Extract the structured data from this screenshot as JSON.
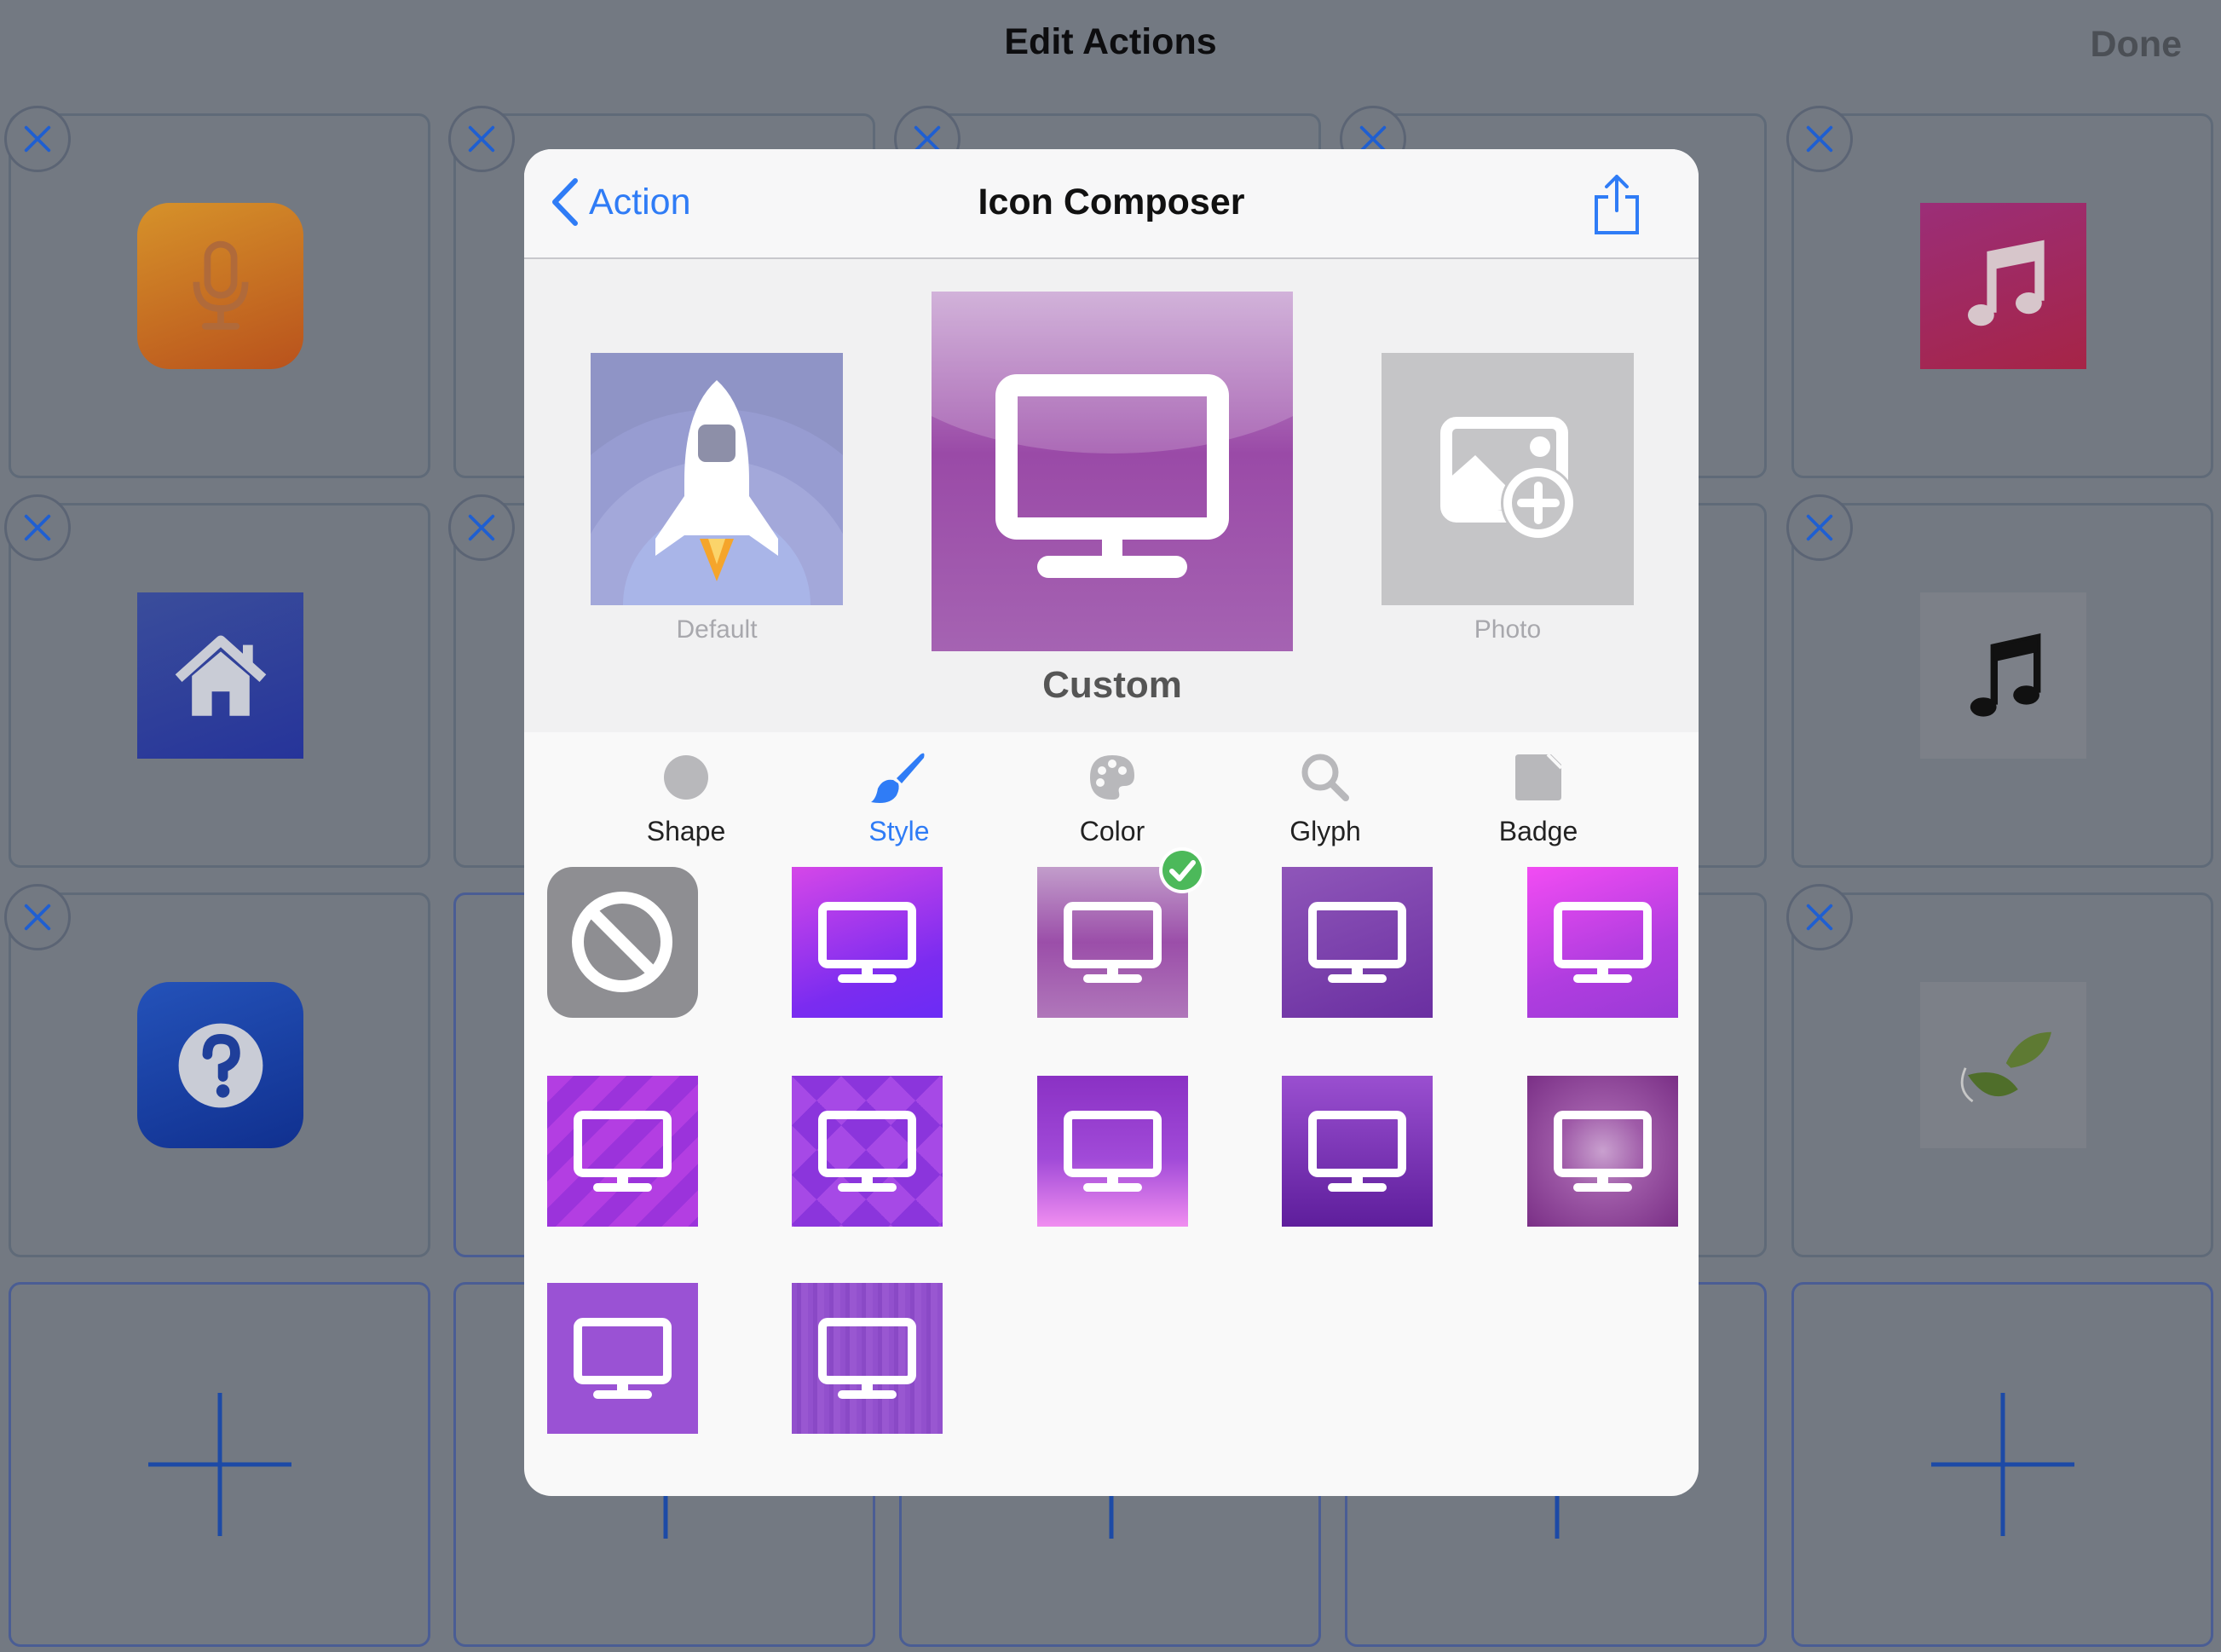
{
  "screen": {
    "title": "Edit Actions",
    "done_label": "Done"
  },
  "background_grid": {
    "icons": [
      "microphone-icon",
      "music-note-icon",
      "home-icon",
      "music-note-black-icon",
      "help-icon",
      "leaf-icon"
    ],
    "delete_icon": "close-icon",
    "add_icon": "plus-icon"
  },
  "modal": {
    "back_label": "Action",
    "title": "Icon Composer",
    "share_icon": "share-icon",
    "previews": {
      "default_label": "Default",
      "custom_label": "Custom",
      "photo_label": "Photo"
    },
    "tabs": [
      {
        "label": "Shape",
        "icon": "circle-icon"
      },
      {
        "label": "Style",
        "icon": "paintbrush-icon",
        "active": true
      },
      {
        "label": "Color",
        "icon": "palette-icon"
      },
      {
        "label": "Glyph",
        "icon": "magnifier-icon"
      },
      {
        "label": "Badge",
        "icon": "badge-icon"
      }
    ],
    "styles": {
      "count": 12,
      "selected_index": 2,
      "selected_icon": "checkmark-icon",
      "none_icon": "prohibited-icon",
      "swatch_icon": "monitor-icon"
    },
    "colors": {
      "accent": "#2f7cf6",
      "selected_check": "#4cb95a"
    }
  }
}
